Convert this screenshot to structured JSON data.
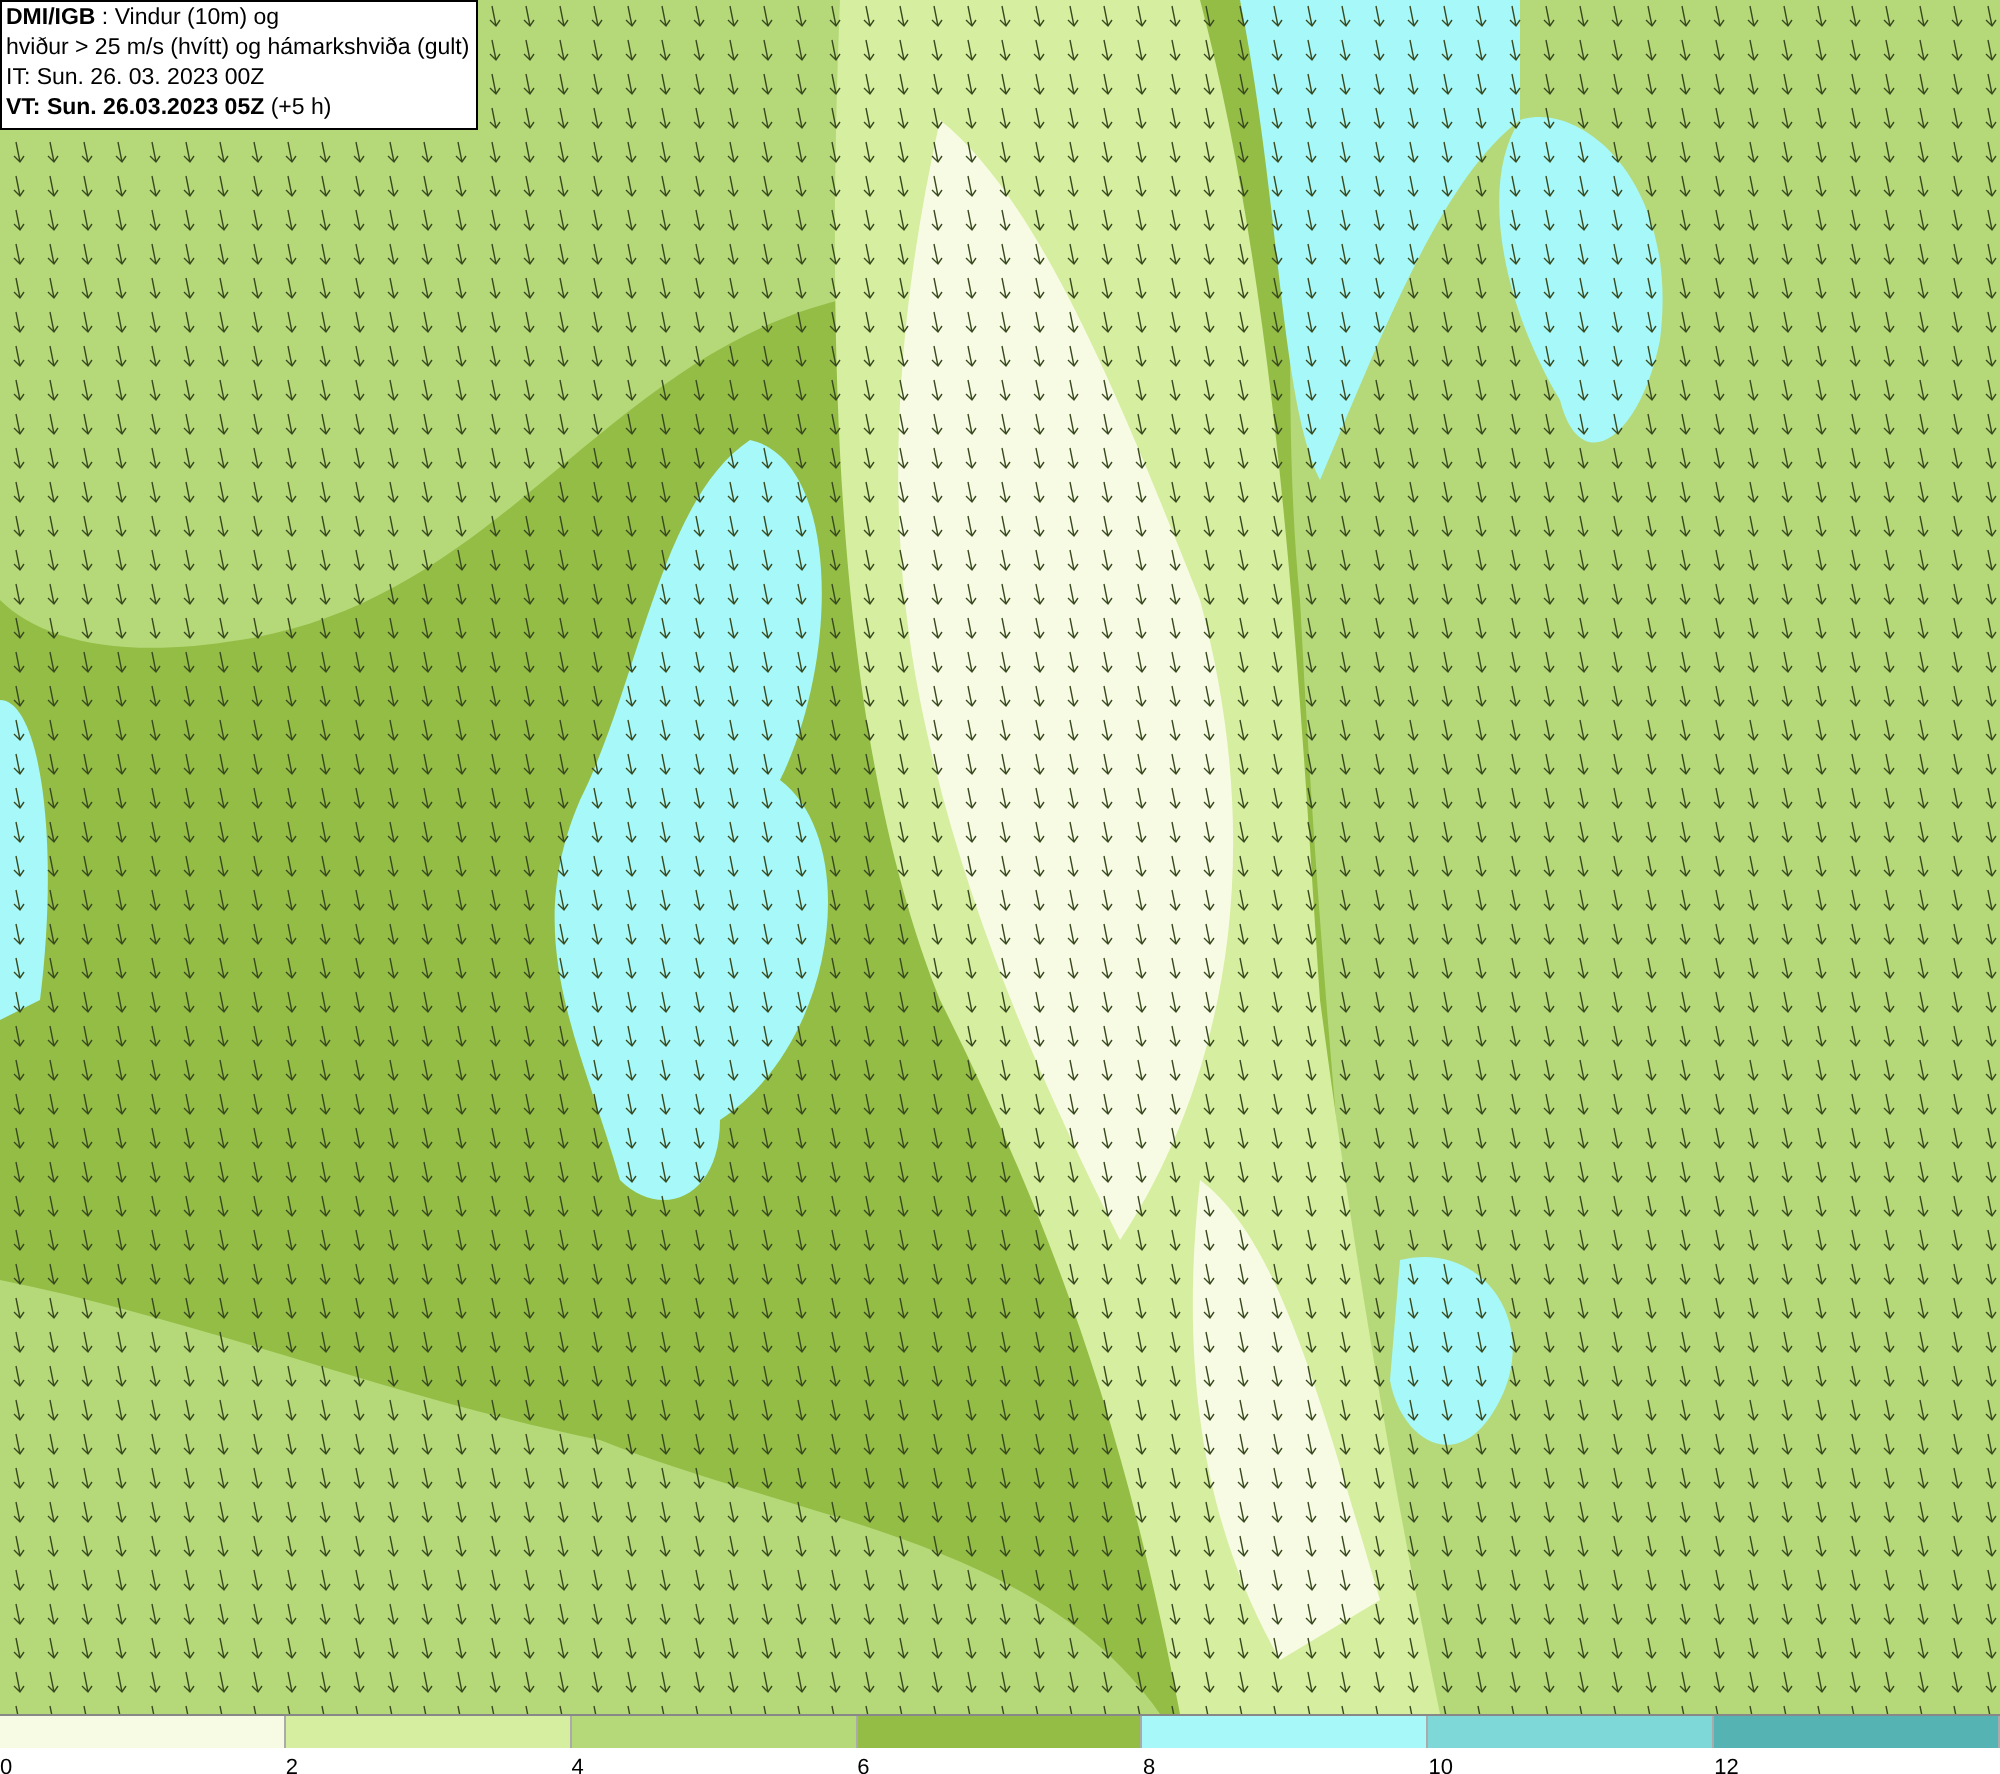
{
  "header": {
    "lines": [
      "**DMI/IGB** : Vindur (10m) og",
      "hviður > 25 m/s (hvítt) og hámarkshviða (gult)",
      "IT: Sun. 26. 03. 2023 00Z",
      "**VT: Sun. 26.03.2023 05Z** (+5 h)"
    ]
  },
  "legend": {
    "segments": [
      {
        "label": "0",
        "color": "#f7fbe3"
      },
      {
        "label": "2",
        "color": "#d6eea0"
      },
      {
        "label": "4",
        "color": "#b5d979"
      },
      {
        "label": "6",
        "color": "#93bd45"
      },
      {
        "label": "8",
        "color": "#a7f8f8"
      },
      {
        "label": "10",
        "color": "#7fd8d8"
      },
      {
        "label": "12",
        "color": "#55b3b3"
      }
    ]
  }
}
